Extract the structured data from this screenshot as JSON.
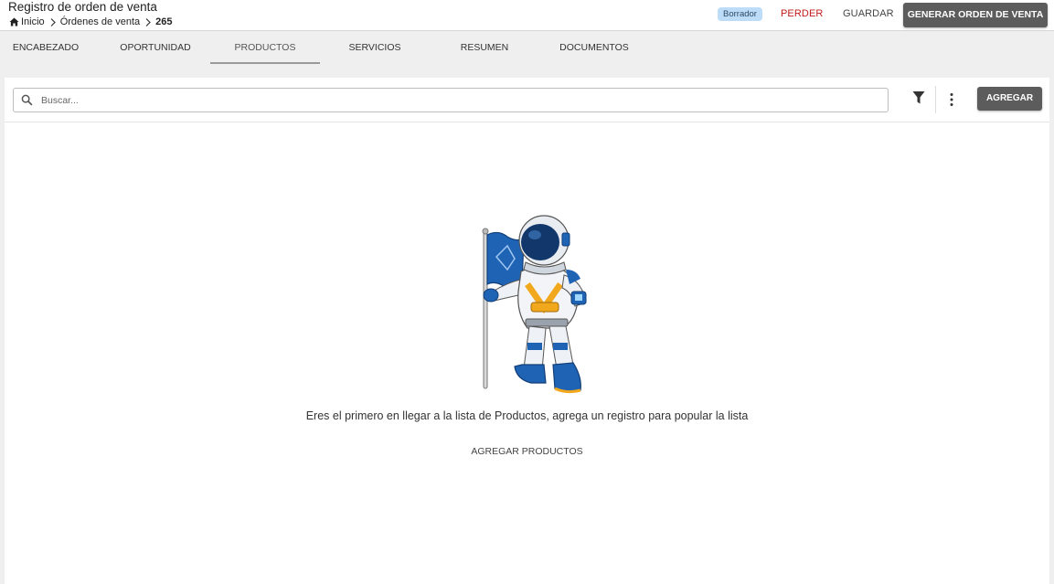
{
  "header": {
    "title": "Registro de orden de venta",
    "breadcrumb": {
      "home": "Inicio",
      "section": "Órdenes de venta",
      "current": "265"
    },
    "status_badge": "Borrador",
    "actions": {
      "lose": "PERDER",
      "save": "GUARDAR",
      "generate": "GENERAR ORDEN DE VENTA"
    }
  },
  "tabs": [
    {
      "label": "ENCABEZADO",
      "active": false
    },
    {
      "label": "OPORTUNIDAD",
      "active": false
    },
    {
      "label": "PRODUCTOS",
      "active": true
    },
    {
      "label": "SERVICIOS",
      "active": false
    },
    {
      "label": "RESUMEN",
      "active": false
    },
    {
      "label": "DOCUMENTOS",
      "active": false
    }
  ],
  "toolbar": {
    "search_placeholder": "Buscar...",
    "search_value": "",
    "filter_icon": "filter-icon",
    "more_icon": "more-vert-icon",
    "add_label": "AGREGAR"
  },
  "empty_state": {
    "message": "Eres el primero en llegar a la lista de Productos, agrega un registro para popular la lista",
    "action": "AGREGAR PRODUCTOS",
    "illustration": "astronaut-with-flag"
  },
  "colors": {
    "accent_dark": "#5c5c5c",
    "danger": "#c21b1b",
    "badge_bg": "#bcdcf7",
    "astronaut_blue": "#1f63b5",
    "astronaut_yellow": "#f2a81d"
  }
}
